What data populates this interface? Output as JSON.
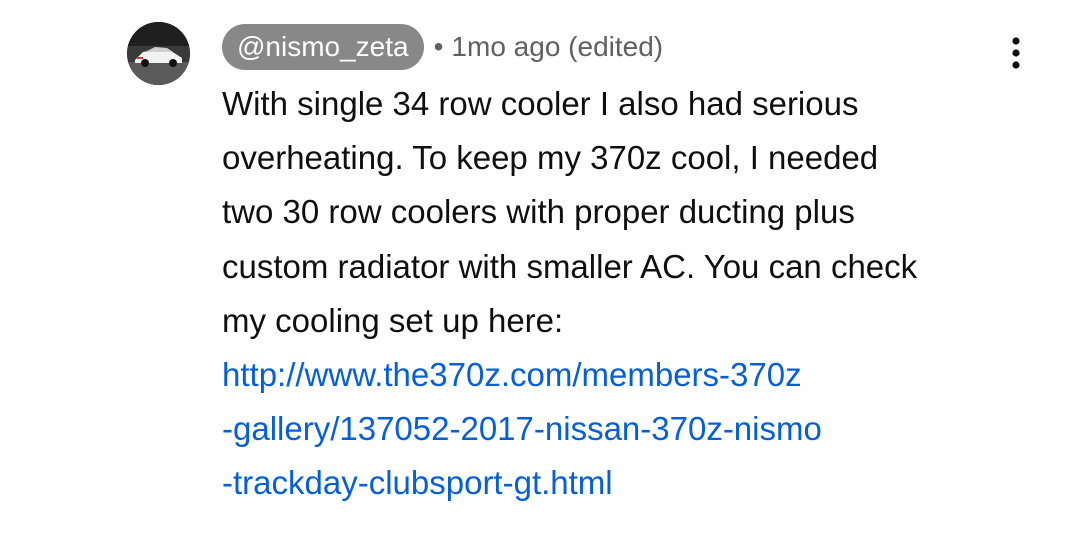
{
  "comment": {
    "author": "@nismo_zeta",
    "separator": "•",
    "timestamp": "1mo ago (edited)",
    "menu_icon": "more-vert-icon",
    "avatar_icon": "car-avatar-icon",
    "body_lines": [
      "With single 34 row cooler I also had serious",
      "overheating. To keep my 370z cool, I needed",
      "two 30 row coolers with proper ducting plus",
      "custom radiator with smaller AC. You can check",
      "my cooling set up here:"
    ],
    "link_lines": [
      "http://www.the370z.com/members-370z",
      "-gallery/137052-2017-nissan-370z-nismo",
      "-trackday-clubsport-gt.html"
    ],
    "colors": {
      "author_chip_bg": "#888888",
      "link": "#065fd4",
      "meta": "#606060",
      "text": "#0f0f0f"
    }
  }
}
